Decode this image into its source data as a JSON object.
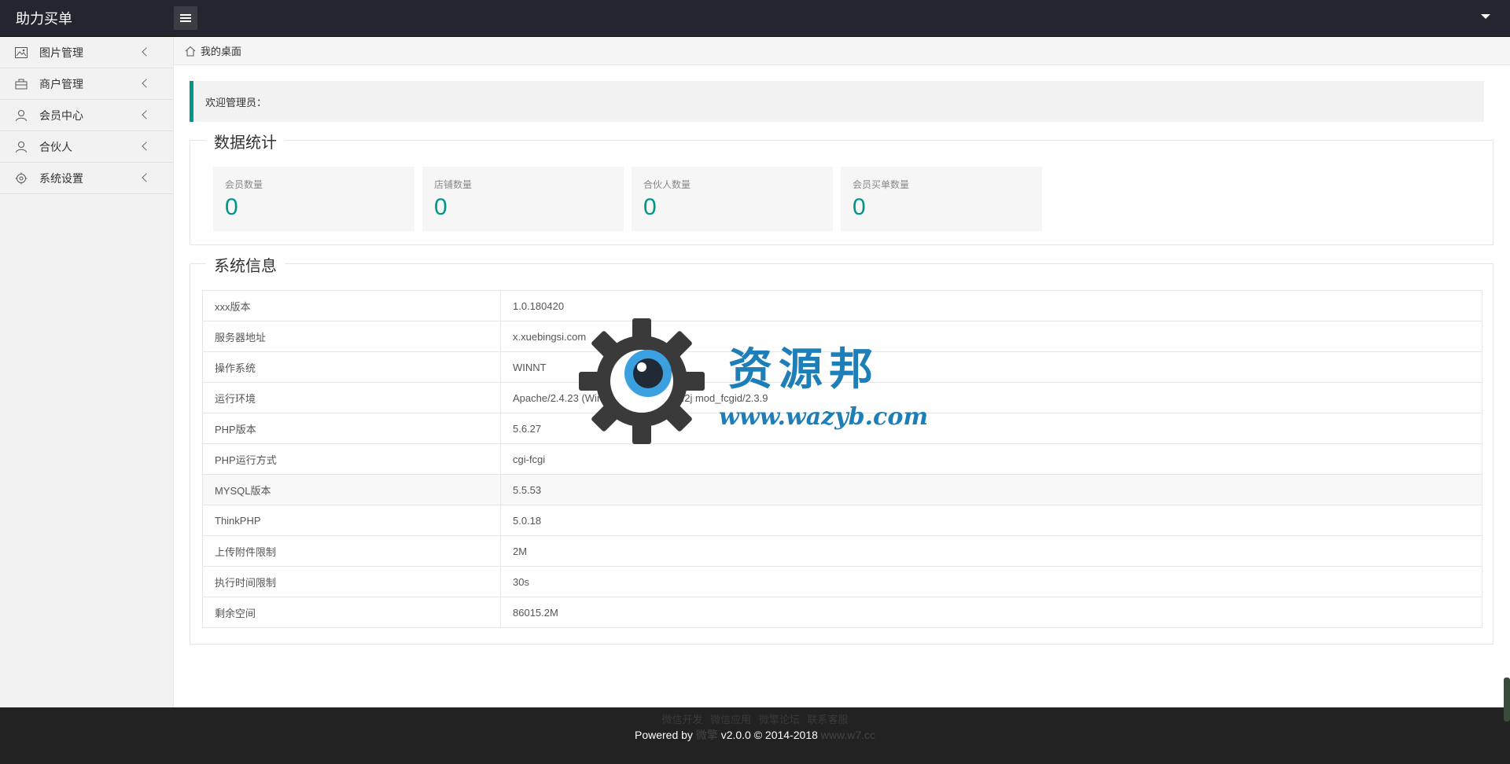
{
  "header": {
    "title": "助力买单"
  },
  "sidebar": {
    "items": [
      {
        "label": "图片管理",
        "icon": "image-icon"
      },
      {
        "label": "商户管理",
        "icon": "shop-icon"
      },
      {
        "label": "会员中心",
        "icon": "user-icon"
      },
      {
        "label": "合伙人",
        "icon": "user-icon"
      },
      {
        "label": "系统设置",
        "icon": "settings-icon"
      }
    ]
  },
  "breadcrumb": {
    "label": "我的桌面"
  },
  "welcome": {
    "text": "欢迎管理员："
  },
  "stats": {
    "title": "数据统计",
    "cards": [
      {
        "label": "会员数量",
        "value": "0"
      },
      {
        "label": "店铺数量",
        "value": "0"
      },
      {
        "label": "合伙人数量",
        "value": "0"
      },
      {
        "label": "会员买单数量",
        "value": "0"
      }
    ]
  },
  "system": {
    "title": "系统信息",
    "rows": [
      {
        "key": "xxx版本",
        "value": "1.0.180420"
      },
      {
        "key": "服务器地址",
        "value": "x.xuebingsi.com"
      },
      {
        "key": "操作系统",
        "value": "WINNT"
      },
      {
        "key": "运行环境",
        "value": "Apache/2.4.23 (Win32) OpenSSL/1.0.2j mod_fcgid/2.3.9"
      },
      {
        "key": "PHP版本",
        "value": "5.6.27"
      },
      {
        "key": "PHP运行方式",
        "value": "cgi-fcgi"
      },
      {
        "key": "MYSQL版本",
        "value": "5.5.53"
      },
      {
        "key": "ThinkPHP",
        "value": "5.0.18"
      },
      {
        "key": "上传附件限制",
        "value": "2M"
      },
      {
        "key": "执行时间限制",
        "value": "30s"
      },
      {
        "key": "剩余空间",
        "value": "86015.2M"
      }
    ]
  },
  "watermark": {
    "name": "资源邦",
    "url": "www.wazyb.com"
  },
  "footer": {
    "links": [
      "微信开发",
      "微信应用",
      "微擎论坛",
      "联系客服"
    ],
    "powered_prefix": "Powered by",
    "brand": "微擎",
    "version": "v2.0.0 © 2014-2018",
    "site": "www.w7.cc"
  },
  "colors": {
    "accent": "#009688",
    "header_bg": "#23262e",
    "sidebar_bg": "#f2f2f2",
    "footer_bg": "#222222"
  }
}
